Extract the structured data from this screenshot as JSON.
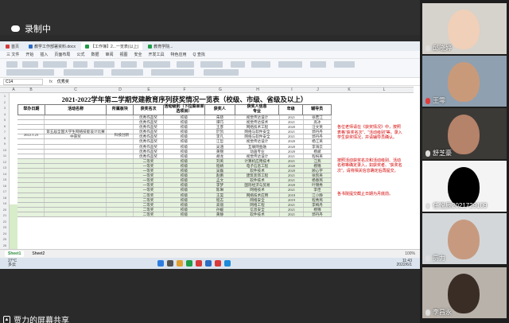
{
  "meeting": {
    "recording_label": "录制中",
    "share_label": "贾力的屏幕共享"
  },
  "browser_tabs": [
    {
      "label": "首页",
      "color": "#d73a3a",
      "active": false
    },
    {
      "label": "教学工作部署资料.docx",
      "color": "#2b6cc4",
      "active": false
    },
    {
      "label": "【工作簿】2...一览表(以上)",
      "color": "#1f9d47",
      "active": true
    },
    {
      "label": "教育学院...",
      "color": "#1f9d47",
      "active": false
    }
  ],
  "menu_items": [
    "三 文件",
    "开始",
    "插入",
    "页面布局",
    "公式",
    "数据",
    "审阅",
    "视图",
    "安全",
    "开发工具",
    "特色应用",
    "Q 查找"
  ],
  "formula_bar": {
    "cell_ref": "C14",
    "formula": "优秀奖"
  },
  "column_headers": [
    "A",
    "B",
    "C",
    "D",
    "E",
    "F",
    "G",
    "H",
    "I",
    "J",
    "K",
    "L"
  ],
  "row_numbers": [
    "1",
    "2",
    "3",
    "4",
    "5",
    "6",
    "7",
    "8",
    "9",
    "10",
    "11",
    "12",
    "13",
    "14",
    "15",
    "16",
    "17",
    "18",
    "19",
    "20",
    "21",
    "22",
    "23",
    "24",
    "25",
    "26"
  ],
  "sheet": {
    "title": "2021-2022学年第二学期党建教育序列获奖情况一览表（校级、市级、省级及以上）",
    "headers": [
      "举办日期",
      "活动名称",
      "所属板块",
      "获奖名次",
      "活动级别（下拉菜单单选项目）",
      "获奖人",
      "专业",
      "年级",
      "辅导员"
    ],
    "award_header": "获奖人信息",
    "sidebar_date": "2022.3.23",
    "sidebar_activity": "第五届全国大学生网络技能设计比赛中获奖",
    "sidebar_section": "科技创新",
    "rows": [
      [
        "优秀作品奖",
        "校级",
        "朱晓",
        "视觉传达设计",
        "2021",
        "徐若江"
      ],
      [
        "优秀作品奖",
        "校级",
        "谭巧",
        "视觉传达技术",
        "2021",
        "高冰"
      ],
      [
        "优秀作品奖",
        "校级",
        "王彦",
        "网络技术工程",
        "2020",
        "汪文英"
      ],
      [
        "优秀作品奖",
        "校级",
        "於凯",
        "网络与软件安全",
        "2021",
        "郭丹丹"
      ],
      [
        "优秀作品奖",
        "校级",
        "李凡",
        "网络与软件安全",
        "2021",
        "郭丹丹"
      ],
      [
        "优秀作品奖",
        "校级",
        "江哲",
        "视觉传达设计",
        "2020",
        "杨江英"
      ],
      [
        "优秀作品奖",
        "校级",
        "吴涵",
        "互联网金融",
        "2020",
        "李海云"
      ],
      [
        "优秀作品奖",
        "校级",
        "黄锦",
        "动画专业",
        "2020",
        "杨斌"
      ],
      [
        "优秀作品奖",
        "校级",
        "胡龙",
        "视觉传达设计",
        "2021",
        "程祝英"
      ],
      [
        "二等奖",
        "校级",
        "刘英",
        "计算机应用技术",
        "2021",
        "江燕"
      ],
      [
        "一等奖",
        "校级",
        "程婧",
        "电子信息工程",
        "2020",
        "杨锦"
      ],
      [
        "一等奖",
        "校级",
        "吴磊",
        "软件技术",
        "2020",
        "顾心宇"
      ],
      [
        "一等奖",
        "校级",
        "赵鹏",
        "建筑装饰工程",
        "2021",
        "徐凯英"
      ],
      [
        "一等奖",
        "校级",
        "孟文",
        "软件技术",
        "2021",
        "杨春燕"
      ],
      [
        "一等奖",
        "校级",
        "李梦",
        "国际经济与贸易",
        "2020",
        "叶锦秀"
      ],
      [
        "一等奖",
        "校级",
        "陈琳",
        "网络技术",
        "2021",
        "李佳"
      ],
      [
        "二等奖",
        "校级",
        "王昊",
        "网络技术应用",
        "2018",
        "江小静"
      ],
      [
        "二等奖",
        "校级",
        "程志",
        "网络安全",
        "2019",
        "程秀燕"
      ],
      [
        "二等奖",
        "校级",
        "高丽",
        "网络工程",
        "2021",
        "李梅丹"
      ],
      [
        "二等奖",
        "校级",
        "孙媛",
        "信息安全",
        "2021",
        "杨锦"
      ],
      [
        "二等奖",
        "校级",
        "黄静",
        "软件技术",
        "2021",
        "郭丹丹"
      ]
    ]
  },
  "red_notes": [
    "各位老师请在《获奖情况》中，按照表格“获奖名次”、“活动级别”等，录入学生获奖情况，并请辅导员确认。",
    "按照活动获奖名次和活动级别、活动名称等确定录入，如获奖者、“获奖名次”，请将相关信息确定后再提交。",
    "各书院提交截止日期为月底前。"
  ],
  "status_tabs": [
    "Sheet1",
    "Sheet2"
  ],
  "zoom": "100%",
  "taskbar": {
    "weather_temp": "27°C",
    "weather_desc": "多云",
    "time": "11:43",
    "date": "2022/6/1"
  },
  "participants": [
    {
      "name": "邱晓婷",
      "mic_muted": false,
      "bg": "#d6d2cc",
      "face": "#f0d0b8"
    },
    {
      "name": "王零",
      "mic_muted": true,
      "bg": "#8fa0b0",
      "face": "#c99a7a"
    },
    {
      "name": "舒芝豪",
      "mic_muted": false,
      "bg": "#3c3a36",
      "face": "#b5826a"
    },
    {
      "name": "任悦辰2021729109",
      "mic_muted": false,
      "bg": "#f4f4f4",
      "face": "#000000"
    },
    {
      "name": "贾力",
      "mic_muted": false,
      "bg": "#d3d7da",
      "face": "#c79a80"
    },
    {
      "name": "李昌永",
      "mic_muted": false,
      "bg": "#b8b2ab",
      "face": "#3a2d26"
    }
  ]
}
